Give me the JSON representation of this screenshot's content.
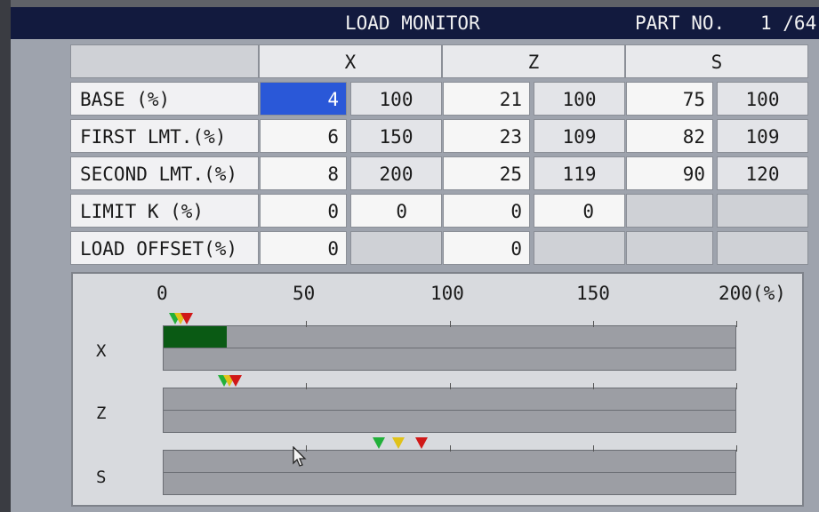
{
  "header": {
    "title": "LOAD MONITOR",
    "part_label": "PART NO.",
    "part_value": "1 /64"
  },
  "table": {
    "axes": [
      "X",
      "Z",
      "S"
    ],
    "rows": [
      {
        "label": "BASE (%)",
        "x": [
          "4",
          "100"
        ],
        "z": [
          "21",
          "100"
        ],
        "s": [
          "75",
          "100"
        ]
      },
      {
        "label": "FIRST LMT.(%)",
        "x": [
          "6",
          "150"
        ],
        "z": [
          "23",
          "109"
        ],
        "s": [
          "82",
          "109"
        ]
      },
      {
        "label": "SECOND LMT.(%)",
        "x": [
          "8",
          "200"
        ],
        "z": [
          "25",
          "119"
        ],
        "s": [
          "90",
          "120"
        ]
      },
      {
        "label": "LIMIT K (%)",
        "x": [
          "0",
          "0"
        ],
        "z": [
          "0",
          "0"
        ],
        "s": [
          "",
          ""
        ]
      },
      {
        "label": "LOAD OFFSET(%)",
        "x": [
          "0",
          ""
        ],
        "z": [
          "0",
          ""
        ],
        "s": [
          "",
          ""
        ]
      }
    ],
    "selected_cell": "BASE X"
  },
  "graph": {
    "scale_labels": [
      "0",
      "50",
      "100",
      "150",
      "200(%)"
    ],
    "scale_max": 200,
    "tracks": [
      {
        "axis": "X",
        "load_percent": 22,
        "markers_percent": {
          "base": 4,
          "first": 6,
          "second": 8
        }
      },
      {
        "axis": "Z",
        "load_percent": 0,
        "markers_percent": {
          "base": 21,
          "first": 23,
          "second": 25
        }
      },
      {
        "axis": "S",
        "load_percent": 0,
        "markers_percent": {
          "base": 75,
          "first": 82,
          "second": 90
        }
      }
    ]
  },
  "colors": {
    "marker_base": "#22b03a",
    "marker_first": "#e0c21a",
    "marker_second": "#d01818",
    "load_fill": "#0a5a14",
    "selection": "#2a58d8"
  },
  "icons": {
    "cursor": "mouse-pointer-icon"
  }
}
